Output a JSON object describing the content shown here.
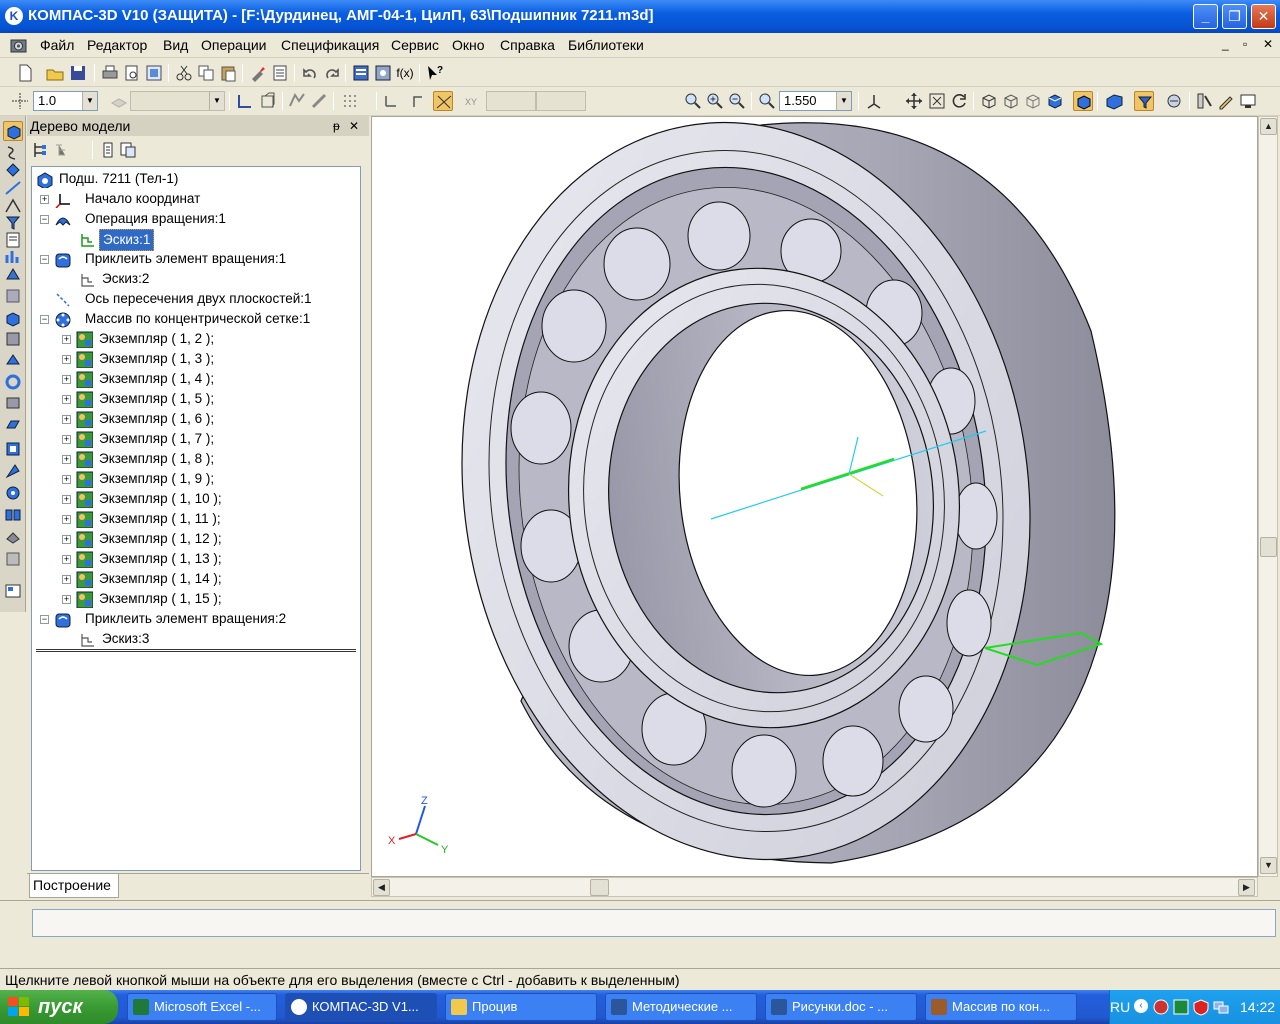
{
  "window": {
    "title": "КОМПАС-3D V10 (ЗАЩИТА) - [F:\\Дурдинец, АМГ-04-1, ЦилП, 63\\Подшипник 7211.m3d]",
    "minimize": "_",
    "maximize": "❐",
    "close": "✕"
  },
  "menu": {
    "items": [
      {
        "label": "Файл"
      },
      {
        "label": "Редактор"
      },
      {
        "label": "Вид"
      },
      {
        "label": "Операции"
      },
      {
        "label": "Спецификация"
      },
      {
        "label": "Сервис"
      },
      {
        "label": "Окно"
      },
      {
        "label": "Справка"
      },
      {
        "label": "Библиотеки"
      }
    ],
    "doc_minimize": "_",
    "doc_restore": "▫",
    "doc_close": "✕"
  },
  "toolbar": {
    "fx_label": "f(x)",
    "step_value": "1.0",
    "zoom_value": "1.550"
  },
  "panel": {
    "title": "Дерево модели",
    "pin": "ᵽ",
    "close": "✕",
    "tab_label": "Построение"
  },
  "tree": {
    "root": "Подш. 7211 (Тел-1)",
    "items": [
      {
        "label": "Начало координат"
      },
      {
        "label": "Операция вращения:1"
      },
      {
        "label": "Эскиз:1"
      },
      {
        "label": "Приклеить элемент вращения:1"
      },
      {
        "label": "Эскиз:2"
      },
      {
        "label": "Ось пересечения двух плоскостей:1"
      },
      {
        "label": "Массив по концентрической сетке:1"
      },
      {
        "label": "Экземпляр ( 1, 2 );"
      },
      {
        "label": "Экземпляр ( 1, 3 );"
      },
      {
        "label": "Экземпляр ( 1, 4 );"
      },
      {
        "label": "Экземпляр ( 1, 5 );"
      },
      {
        "label": "Экземпляр ( 1, 6 );"
      },
      {
        "label": "Экземпляр ( 1, 7 );"
      },
      {
        "label": "Экземпляр ( 1, 8 );"
      },
      {
        "label": "Экземпляр ( 1, 9 );"
      },
      {
        "label": "Экземпляр ( 1, 10 );"
      },
      {
        "label": "Экземпляр ( 1, 11 );"
      },
      {
        "label": "Экземпляр ( 1, 12 );"
      },
      {
        "label": "Экземпляр ( 1, 13 );"
      },
      {
        "label": "Экземпляр ( 1, 14 );"
      },
      {
        "label": "Экземпляр ( 1, 15 );"
      },
      {
        "label": "Приклеить элемент вращения:2"
      },
      {
        "label": "Эскиз:3"
      }
    ]
  },
  "viewport": {
    "axis_x": "X",
    "axis_y": "Y",
    "axis_z": "Z"
  },
  "status": {
    "hint": "Щелкните левой кнопкой мыши на объекте для его выделения (вместе с Ctrl - добавить к выделенным)"
  },
  "taskbar": {
    "start": "пуск",
    "tasks": [
      {
        "label": "Microsoft Excel -..."
      },
      {
        "label": "КОМПАС-3D V1..."
      },
      {
        "label": "Процив"
      },
      {
        "label": "Методические ..."
      },
      {
        "label": "Рисунки.doc - ..."
      },
      {
        "label": "Массив по кон..."
      }
    ],
    "lang": "RU",
    "clock": "14:22"
  },
  "colors": {
    "title_blue": "#0a5ee0",
    "selection": "#316ac5",
    "bearing_face": "#d8d8e2",
    "sketch_green": "#22dd22",
    "axis_cyan": "#22ccee"
  }
}
